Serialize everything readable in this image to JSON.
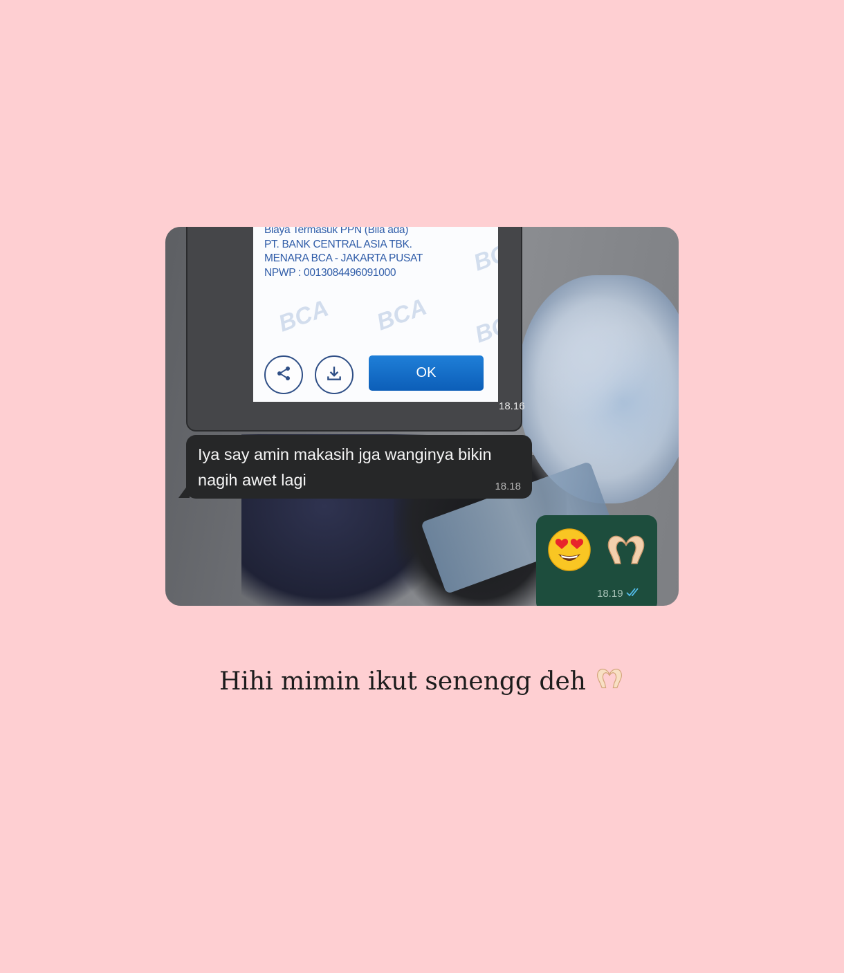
{
  "screenshot": {
    "receipt": {
      "lines": [
        "Biaya Termasuk PPN (Bila ada)",
        "PT. BANK CENTRAL ASIA TBK.",
        "MENARA BCA - JAKARTA PUSAT",
        "NPWP : 0013084496091000"
      ],
      "watermark": "BCA",
      "ok_label": "OK",
      "share_icon": "share-icon",
      "download_icon": "download-icon"
    },
    "messages": [
      {
        "type": "image",
        "time": "18.16"
      },
      {
        "type": "incoming",
        "text": "Iya say amin makasih jga wanginya bikin nagih awet lagi",
        "time": "18.18"
      },
      {
        "type": "outgoing",
        "emojis": [
          "smiling-face-with-heart-eyes",
          "heart-hands"
        ],
        "time": "18.19",
        "status_icon": "double-check-icon"
      }
    ]
  },
  "caption": "Hihi mimin ikut senengg deh",
  "caption_icon": "heart-hands-icon",
  "colors": {
    "background": "#fecfd2",
    "incoming_bubble": "#262728",
    "outgoing_bubble": "#1d4d3d",
    "receipt_text": "#2f5ca8",
    "ok_button": "#0c5eb8",
    "read_check": "#53bdeb"
  }
}
